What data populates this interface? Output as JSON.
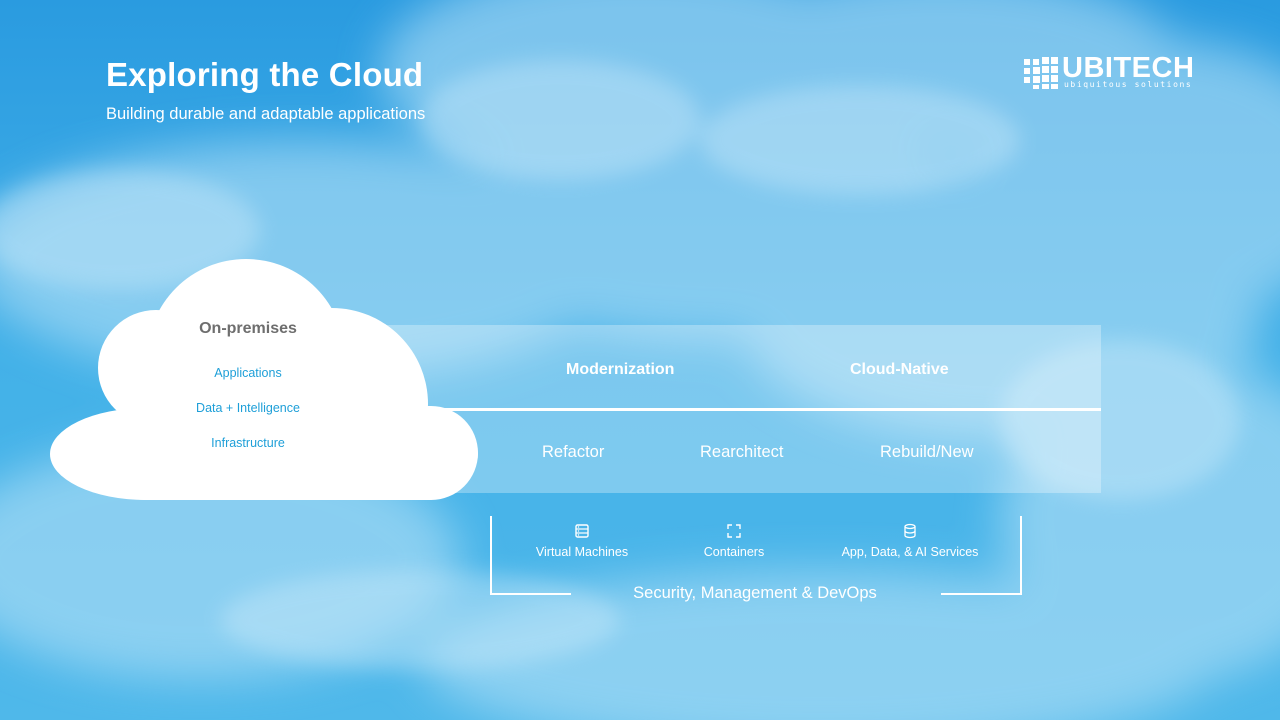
{
  "header": {
    "title": "Exploring the Cloud",
    "subtitle": "Building durable and adaptable applications"
  },
  "logo": {
    "name": "UBITECH",
    "tagline": "ubiquitous solutions"
  },
  "on_premises": {
    "title": "On-premises",
    "items": [
      "Applications",
      "Data + Intelligence",
      "Infrastructure"
    ]
  },
  "band": {
    "headers": [
      "Modernization",
      "Cloud-Native"
    ],
    "steps": [
      "Refactor",
      "Rearchitect",
      "Rebuild/New"
    ]
  },
  "services": {
    "items": [
      {
        "label": "Virtual Machines",
        "icon": "server-icon"
      },
      {
        "label": "Containers",
        "icon": "container-icon"
      },
      {
        "label": "App, Data, & AI Services",
        "icon": "database-icon"
      }
    ],
    "footer": "Security, Management & DevOps"
  },
  "colors": {
    "sky": "#2fa3e0",
    "accent_text": "#1e9fd8",
    "cloud_title": "#6e6e6e",
    "white": "#ffffff"
  }
}
